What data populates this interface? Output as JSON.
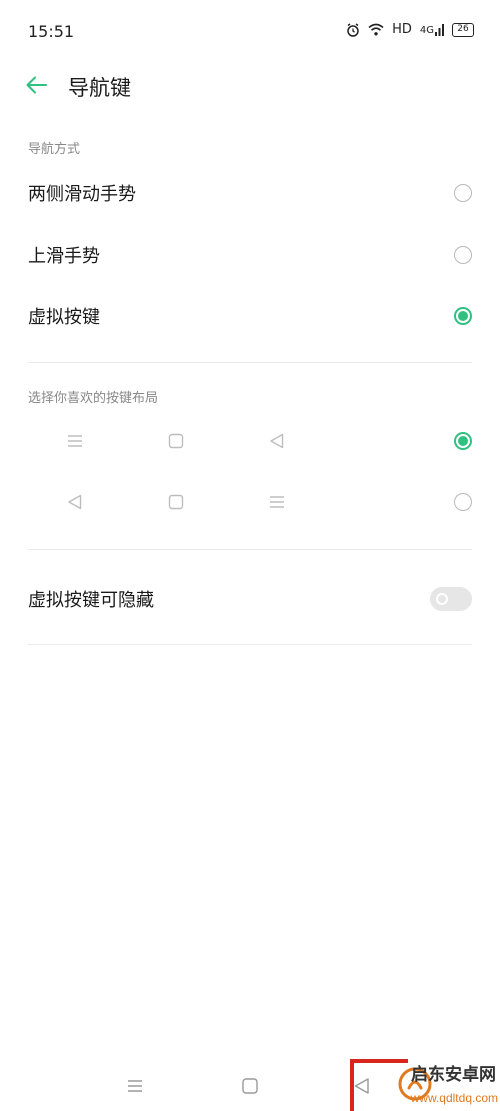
{
  "status_bar": {
    "time": "15:51",
    "hd": "HD",
    "signal": "4G",
    "battery": "26"
  },
  "header": {
    "title": "导航键"
  },
  "nav_mode": {
    "label": "导航方式",
    "options": [
      {
        "label": "两侧滑动手势",
        "selected": false
      },
      {
        "label": "上滑手势",
        "selected": false
      },
      {
        "label": "虚拟按键",
        "selected": true
      }
    ]
  },
  "button_layout": {
    "label": "选择你喜欢的按键布局",
    "options": [
      {
        "icons": [
          "menu-icon",
          "home-square-icon",
          "back-triangle-icon"
        ],
        "selected": true
      },
      {
        "icons": [
          "back-triangle-icon",
          "home-square-icon",
          "menu-icon"
        ],
        "selected": false
      }
    ]
  },
  "hide_toggle": {
    "label": "虚拟按键可隐藏",
    "enabled": false
  },
  "bottom_nav": {
    "icons": [
      "menu-icon",
      "home-square-icon",
      "back-triangle-icon"
    ]
  },
  "watermark": {
    "text": "启东安卓网",
    "url": "www.qdltdq.com"
  },
  "colors": {
    "accent": "#2fc17f",
    "text": "#1a1a1a",
    "secondary_text": "#888888",
    "divider": "#ececec"
  }
}
